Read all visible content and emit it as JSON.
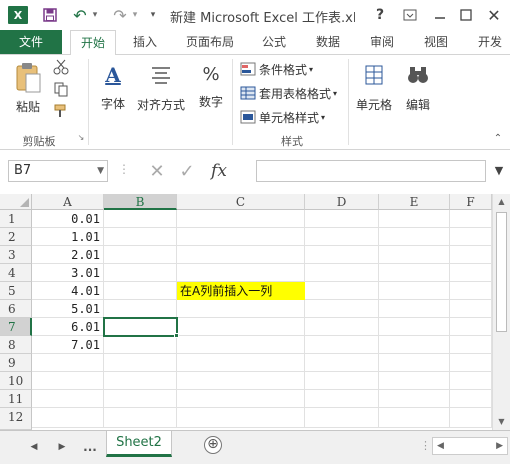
{
  "window": {
    "title": "新建 Microsoft Excel 工作表.xls...",
    "app_icon": "X",
    "help": "?"
  },
  "tabs": [
    {
      "label": "文件",
      "name": "tab-file"
    },
    {
      "label": "开始",
      "name": "tab-home"
    },
    {
      "label": "插入",
      "name": "tab-insert"
    },
    {
      "label": "页面布局",
      "name": "tab-page-layout"
    },
    {
      "label": "公式",
      "name": "tab-formulas"
    },
    {
      "label": "数据",
      "name": "tab-data"
    },
    {
      "label": "审阅",
      "name": "tab-review"
    },
    {
      "label": "视图",
      "name": "tab-view"
    },
    {
      "label": "开发",
      "name": "tab-developer"
    }
  ],
  "ribbon": {
    "paste": "粘贴",
    "clipboard_group": "剪贴板",
    "font": "字体",
    "alignment": "对齐方式",
    "number": "数字",
    "conditional_format": "条件格式",
    "format_table": "套用表格格式",
    "cell_styles": "单元格样式",
    "styles_group": "样式",
    "cells": "单元格",
    "editing": "编辑",
    "percent_symbol": "%",
    "font_symbol": "A"
  },
  "formula_bar": {
    "name_box": "B7",
    "fx": "fx",
    "formula": ""
  },
  "columns": [
    "A",
    "B",
    "C",
    "D",
    "E",
    "F"
  ],
  "rows": [
    "1",
    "2",
    "3",
    "4",
    "5",
    "6",
    "7",
    "8",
    "9",
    "10",
    "11",
    "12"
  ],
  "cells_A": [
    "0.01",
    "1.01",
    "2.01",
    "3.01",
    "4.01",
    "5.01",
    "6.01",
    "7.01"
  ],
  "note": "在A列前插入一列",
  "selected": {
    "column": "B",
    "row": "7"
  },
  "sheets": {
    "ellipsis": "...",
    "active": "Sheet2",
    "add": "⊕"
  },
  "colors": {
    "excel_green": "#217346",
    "highlight": "#ffff00"
  }
}
